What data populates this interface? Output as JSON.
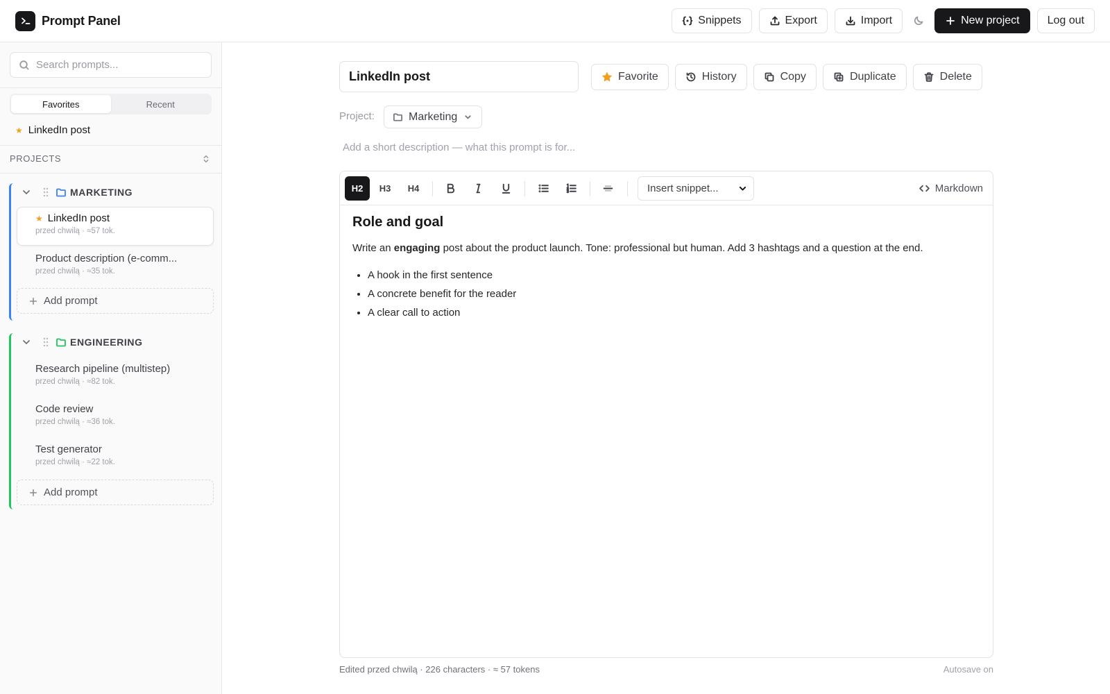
{
  "app": {
    "title": "Prompt Panel"
  },
  "header": {
    "snippets": "Snippets",
    "export": "Export",
    "import": "Import",
    "new_project": "New project",
    "logout": "Log out"
  },
  "sidebar": {
    "search_placeholder": "Search prompts...",
    "tabs": {
      "favorites": "Favorites",
      "recent": "Recent"
    },
    "favorites": [
      {
        "title": "LinkedIn post"
      }
    ],
    "projects_label": "PROJECTS",
    "projects": [
      {
        "name": "MARKETING",
        "accent": "#3b82f6",
        "prompts": [
          {
            "title": "LinkedIn post",
            "meta": "przed chwilą · ≈57 tok.",
            "favorite": true
          },
          {
            "title": "Product description (e-comm...",
            "meta": "przed chwilą · ≈35 tok."
          }
        ],
        "add_label": "Add prompt"
      },
      {
        "name": "ENGINEERING",
        "accent": "#22c55e",
        "prompts": [
          {
            "title": "Research pipeline (multistep)",
            "meta": "przed chwilą · ≈82 tok."
          },
          {
            "title": "Code review",
            "meta": "przed chwilą · ≈36 tok."
          },
          {
            "title": "Test generator",
            "meta": "przed chwilą · ≈22 tok."
          }
        ],
        "add_label": "Add prompt"
      }
    ]
  },
  "editor": {
    "title_value": "LinkedIn post",
    "actions": {
      "favorite": "Favorite",
      "history": "History",
      "copy": "Copy",
      "duplicate": "Duplicate",
      "delete": "Delete"
    },
    "project_label": "Project:",
    "project_value": "Marketing",
    "description_placeholder": "Add a short description — what this prompt is for...",
    "toolbar": {
      "h2": "H2",
      "h3": "H3",
      "h4": "H4",
      "snippet_select": "Insert snippet...",
      "markdown": "Markdown"
    },
    "content": {
      "heading": "Role and goal",
      "para_before": "Write an ",
      "para_bold": "engaging",
      "para_after": " post about the product launch. Tone: professional but human. Add 3 hashtags and a question at the end.",
      "bullets": [
        "A hook in the first sentence",
        "A concrete benefit for the reader",
        "A clear call to action"
      ]
    },
    "footer_left": "Edited przed chwilą · 226 characters · ≈ 57 tokens",
    "footer_right": "Autosave on"
  },
  "colors": {
    "favorite_star": "#f0a020",
    "primary": "#18181b"
  }
}
